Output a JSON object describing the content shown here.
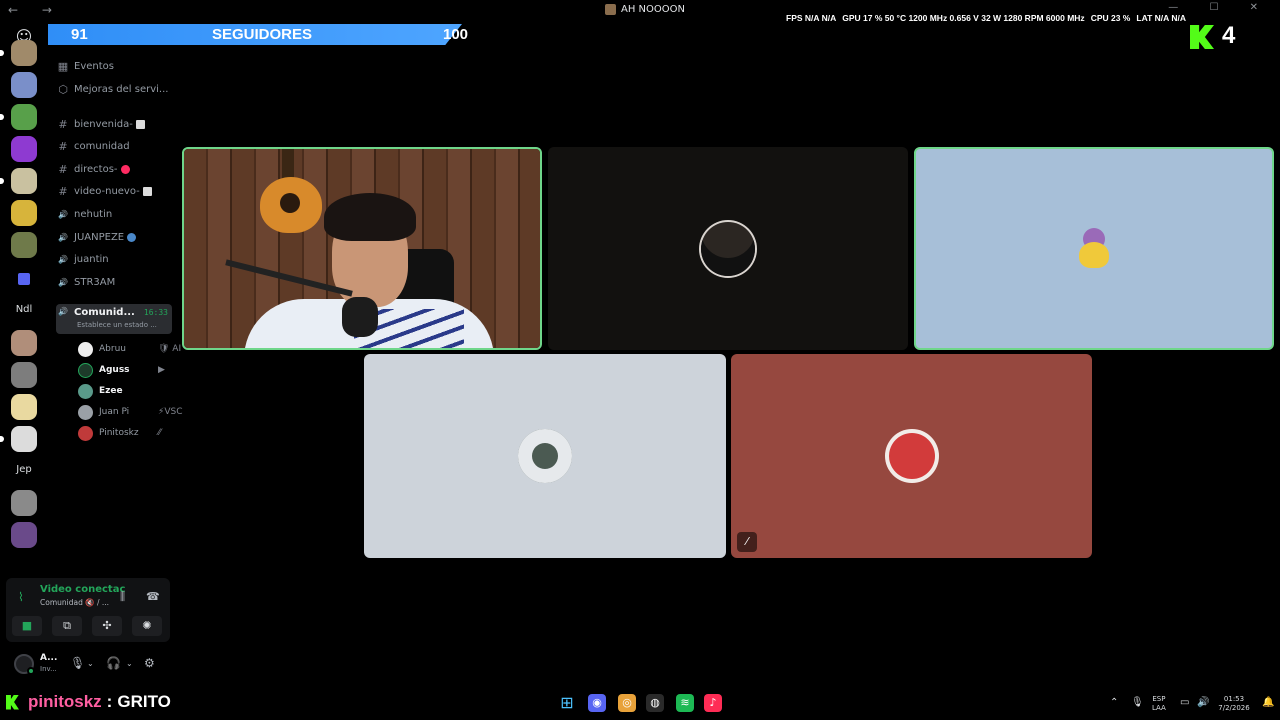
{
  "window": {
    "title": "AH NOOOON",
    "nav": "← →",
    "controls": "— ☐ ✕"
  },
  "overlay": {
    "stats": [
      "FPS N/A N/A",
      "GPU 17 % 50 °C 1200 MHz 0.656 V 32 W 1280 RPM 6000 MHz",
      "CPU 23 %",
      "LAT N/A N/A"
    ],
    "followers_current": "91",
    "followers_label": "SEGUIDORES",
    "followers_goal": "100",
    "followers_progress": 0.91,
    "kick_viewers": "4"
  },
  "servers": [
    {
      "color": "#a08a6a"
    },
    {
      "color": "#7a8fc9"
    },
    {
      "color": "#58a04a"
    },
    {
      "color": "#8e3ad1"
    },
    {
      "color": "#c9c1a0"
    },
    {
      "color": "#d7b43b"
    },
    {
      "color": "#6f7a4a"
    },
    {
      "color": "#5865f2"
    },
    {
      "label": "Ndl"
    },
    {
      "color": "#b08e7a"
    },
    {
      "color": "#7d7d7d"
    },
    {
      "color": "#e9d9a0"
    },
    {
      "color": "#dcdcdc"
    },
    {
      "label": "Jep"
    },
    {
      "color": "#8a8a8a"
    },
    {
      "color": "#6a4a8a"
    }
  ],
  "sidebar": {
    "top_items": [
      {
        "icon": "▦",
        "label": "Eventos"
      },
      {
        "icon": "⬡",
        "label": "Mejoras del servi..."
      }
    ],
    "channels": [
      {
        "icon": "#",
        "label": "bienvenida-",
        "kind": "text",
        "emoji_color": "#dcdcdc"
      },
      {
        "icon": "#",
        "label": "comunidad",
        "kind": "text"
      },
      {
        "icon": "#",
        "label": "directos-",
        "kind": "text",
        "emoji_color": "#ff2b62"
      },
      {
        "icon": "#",
        "label": "video-nuevo-",
        "kind": "text",
        "emoji_color": "#dcdcdc"
      },
      {
        "icon": "🔊",
        "label": "nehutin",
        "kind": "voice"
      },
      {
        "icon": "🔊",
        "label": "JUANPEZE",
        "kind": "voice",
        "emoji_color": "#4a88c9"
      },
      {
        "icon": "🔊",
        "label": "juantin",
        "kind": "voice"
      },
      {
        "icon": "🔊",
        "label": "STR3AM",
        "kind": "voice"
      }
    ],
    "active_channel": {
      "label": "Comunid...",
      "time": "16:33",
      "status": "Establece un estado ..."
    },
    "voice_users": [
      {
        "name": "Abruu",
        "tail": "🛡 AI",
        "avatar": "#eeeeee",
        "style": "dim"
      },
      {
        "name": "Aguss",
        "tail": "▶",
        "avatar": "#1d3a2a",
        "style": "bold"
      },
      {
        "name": "Ezee",
        "tail": "",
        "avatar": "#5a9a8a",
        "style": "bold"
      },
      {
        "name": "Juan Pi",
        "tail": "⚡VSC",
        "avatar": "#9aa0a6",
        "style": "dim"
      },
      {
        "name": "Pinitoskz",
        "tail": "⁄⁄",
        "avatar": "#c03a3a",
        "style": "dim"
      }
    ]
  },
  "voice_panel": {
    "title": "Video conectac",
    "subtitle": "Comunidad 🔇 / ...",
    "buttons": [
      {
        "name": "camera-button",
        "icon": "■",
        "bg": "#1e1f22",
        "color": "#23a55a"
      },
      {
        "name": "screen-share-button",
        "icon": "⧉",
        "bg": "#1e1f22",
        "color": "#dbdee1"
      },
      {
        "name": "activities-button",
        "icon": "✣",
        "bg": "#1e1f22",
        "color": "#dbdee1"
      },
      {
        "name": "soundboard-button",
        "icon": "✺",
        "bg": "#1e1f22",
        "color": "#dbdee1"
      }
    ]
  },
  "user_panel": {
    "name": "A...",
    "status": "Inv..."
  },
  "tiles": [
    {
      "name": "tile-webcam",
      "kind": "webcam",
      "speaking": true
    },
    {
      "name": "tile-user-2",
      "bg": "#12110f",
      "avatar": "#2b2622",
      "speaking": false
    },
    {
      "name": "tile-user-3",
      "bg": "#a7bfd8",
      "avatar": "#f0c93a",
      "speaking": true
    },
    {
      "name": "tile-user-4",
      "bg": "#cdd3da",
      "avatar": "#4b5a52",
      "speaking": false
    },
    {
      "name": "tile-user-5",
      "bg": "#96483f",
      "avatar": "#d23b3b",
      "speaking": false,
      "muted": true
    }
  ],
  "chat": {
    "user": "pinitoskz",
    "separator": ":",
    "message": "GRITO"
  },
  "taskbar": {
    "apps": [
      {
        "name": "windows-start-icon",
        "icon": "⊞",
        "color": "#4cc2ff"
      },
      {
        "name": "discord-app-icon",
        "icon": "◉",
        "color": "#5865f2"
      },
      {
        "name": "chrome-app-icon",
        "icon": "◎",
        "color": "#e8a23a"
      },
      {
        "name": "obs-app-icon",
        "icon": "◍",
        "color": "#2a2a2a"
      },
      {
        "name": "spotify-app-icon",
        "icon": "≋",
        "color": "#1db954"
      },
      {
        "name": "tiktok-app-icon",
        "icon": "♪",
        "color": "#fe2c55"
      }
    ],
    "language": "ESP",
    "language_sub": "LAA",
    "time": "01:53",
    "date": "7/2/2026"
  }
}
